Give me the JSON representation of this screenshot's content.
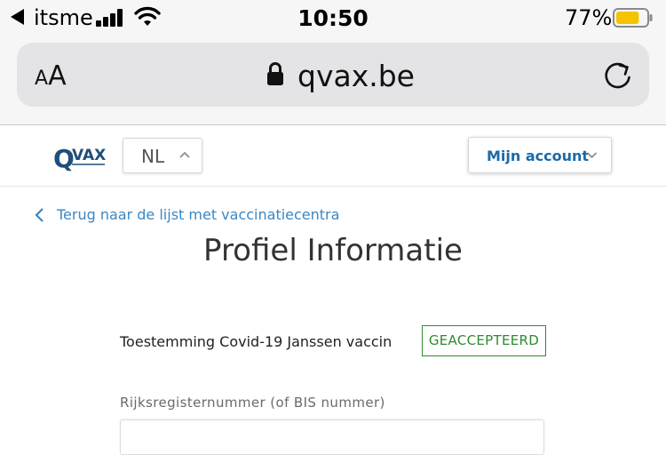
{
  "status_bar": {
    "carrier": "itsme",
    "time": "10:50",
    "battery_percent": "77%",
    "battery_level": 0.77,
    "battery_color": "#f5c400",
    "icons": [
      "back-arrow-icon",
      "cellular-signal-icon",
      "wifi-icon",
      "battery-icon"
    ]
  },
  "browser": {
    "text_size_label": "AA",
    "url": "qvax.be",
    "icons": [
      "lock-icon",
      "reload-icon"
    ]
  },
  "header": {
    "logo_text": "QVAX",
    "language": "NL",
    "account_label": "Mijn account",
    "brand_color": "#1f4e79",
    "link_color": "#1a6aa8"
  },
  "main": {
    "back_link": "Terug naar de lijst met vaccinatiecentra",
    "title": "Profiel Informatie",
    "consent": {
      "label": "Toestemming Covid-19 Janssen vaccin",
      "status": "GEACCEPTEERD",
      "status_color": "#2e8b2e"
    },
    "national_number": {
      "label": "Rijksregisternummer (of BIS nummer)",
      "value": ""
    }
  }
}
